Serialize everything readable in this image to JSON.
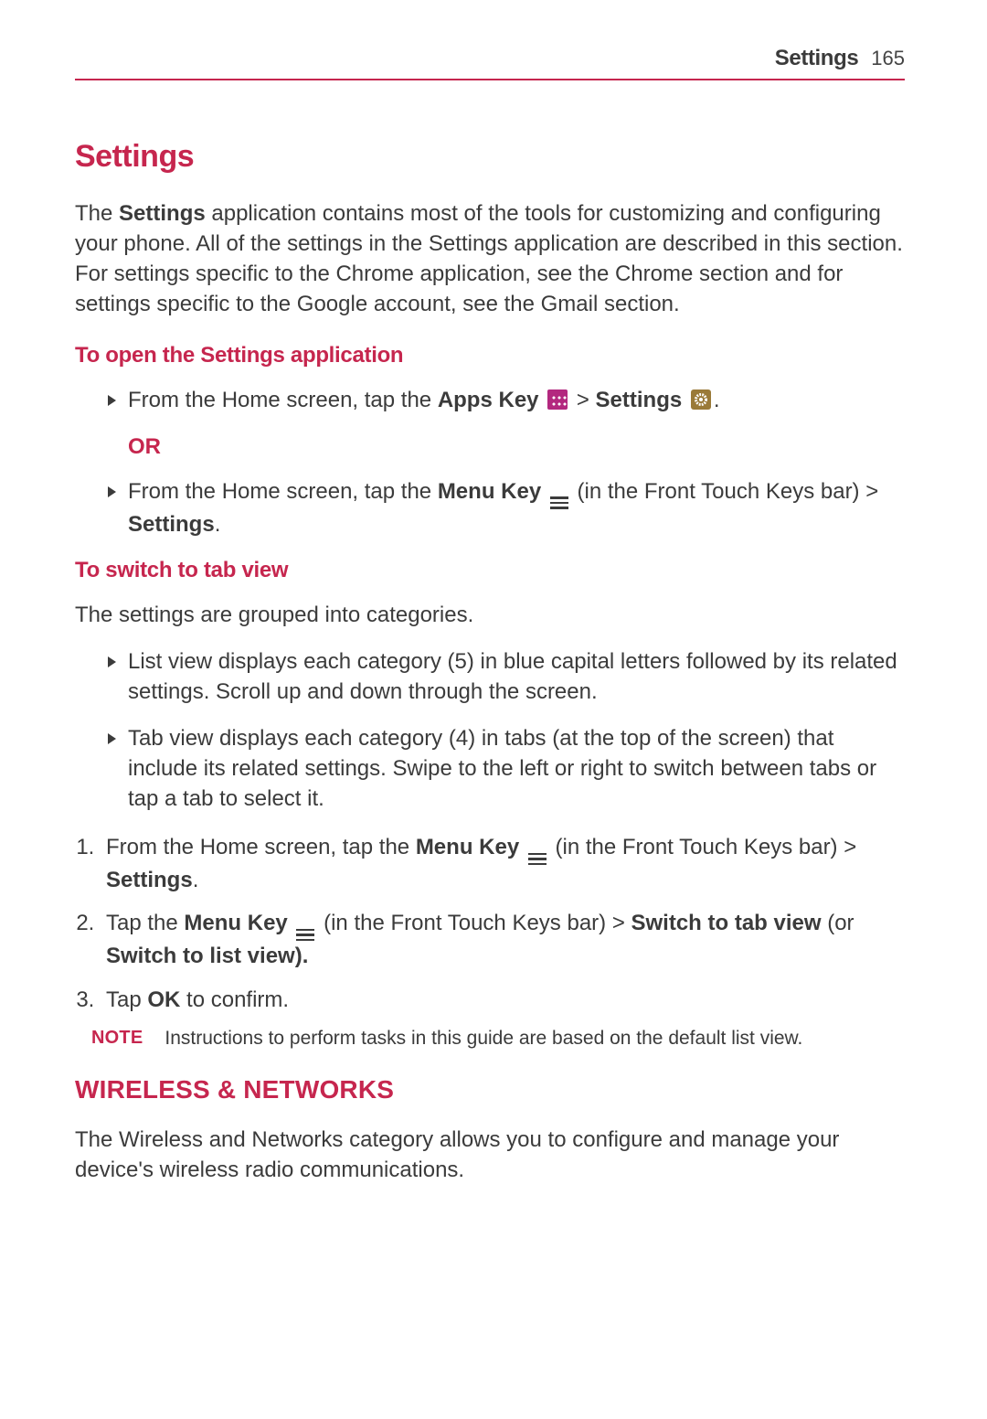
{
  "header": {
    "title": "Settings",
    "pageNumber": "165"
  },
  "h1": "Settings",
  "intro": {
    "prefix": "The ",
    "bold1": "Settings",
    "rest": " application contains most of the tools for customizing and configuring your phone. All of the settings in the Settings application are described in this section. For settings specific to the Chrome application, see the Chrome section and for settings specific to the Google account, see the Gmail section."
  },
  "section_open": {
    "title": "To open the Settings application",
    "item1": {
      "t1": "From the Home screen, tap the ",
      "b1": "Apps Key",
      "t2": " > ",
      "b2": "Settings",
      "t3": "."
    },
    "or": "OR",
    "item2": {
      "t1": "From the Home screen, tap the ",
      "b1": "Menu Key",
      "t2": " (in the Front Touch Keys bar) > ",
      "b2": "Settings",
      "t3": "."
    }
  },
  "section_switch": {
    "title": "To switch to tab view",
    "lead": "The settings are grouped into categories.",
    "bullet1": "List view displays each category (5) in blue capital letters followed by its related settings. Scroll up and down through the screen.",
    "bullet2": "Tab view displays each category (4) in tabs (at the top of the screen) that include its related settings. Swipe to the left or right to switch between tabs or tap a tab to select it.",
    "step1": {
      "t1": "From the Home screen, tap the ",
      "b1": "Menu Key",
      "t2": " (in the Front Touch Keys bar) > ",
      "b2": "Settings",
      "t3": "."
    },
    "step2": {
      "t1": "Tap the ",
      "b1": "Menu Key",
      "t2": " (in the Front Touch Keys bar) > ",
      "b2": "Switch to tab view",
      "t3": " (or ",
      "b3": "Switch to list view).",
      "t4": ""
    },
    "step3": {
      "t1": "Tap ",
      "b1": "OK",
      "t2": " to confirm."
    }
  },
  "note": {
    "label": "NOTE",
    "text": "Instructions to perform tasks in this guide are based on the default list view."
  },
  "wireless": {
    "title": "WIRELESS & NETWORKS",
    "body": "The Wireless and Networks category allows you to configure and manage your device's wireless radio communications."
  }
}
